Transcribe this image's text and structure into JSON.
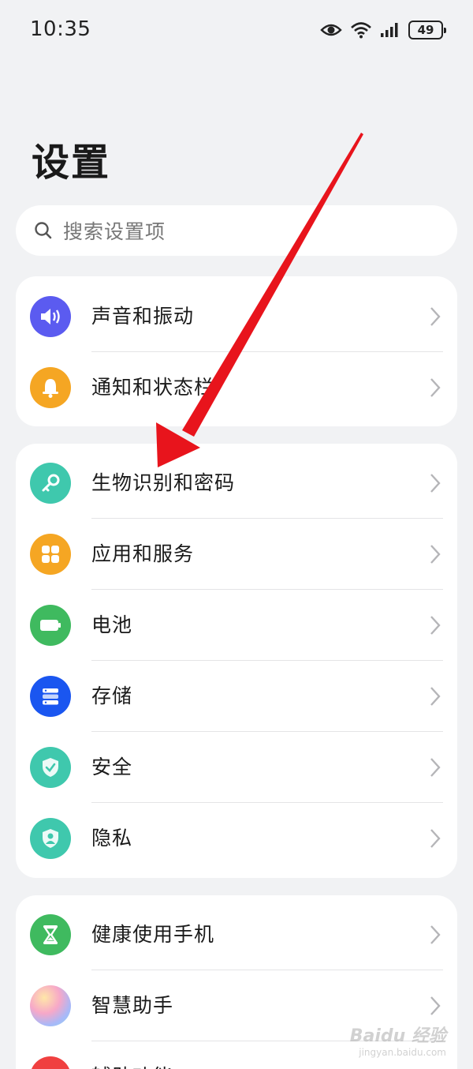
{
  "status_bar": {
    "time": "10:35",
    "battery_level": "49",
    "icons": [
      "eye-icon",
      "wifi-icon",
      "signal-icon",
      "battery-icon"
    ]
  },
  "page": {
    "title": "设置"
  },
  "search": {
    "placeholder": "搜索设置项"
  },
  "groups": [
    {
      "items": [
        {
          "label": "声音和振动",
          "icon": "speaker-icon",
          "color": "#5b5bf0"
        },
        {
          "label": "通知和状态栏",
          "icon": "bell-icon",
          "color": "#f5a623"
        }
      ]
    },
    {
      "items": [
        {
          "label": "生物识别和密码",
          "icon": "key-icon",
          "color": "#3fc8ad"
        },
        {
          "label": "应用和服务",
          "icon": "apps-grid-icon",
          "color": "#f5a623"
        },
        {
          "label": "电池",
          "icon": "battery-icon",
          "color": "#3fba5f"
        },
        {
          "label": "存储",
          "icon": "storage-icon",
          "color": "#1a56f0"
        },
        {
          "label": "安全",
          "icon": "shield-check-icon",
          "color": "#3fc8ad"
        },
        {
          "label": "隐私",
          "icon": "privacy-shield-icon",
          "color": "#3fc8ad"
        }
      ]
    },
    {
      "items": [
        {
          "label": "健康使用手机",
          "icon": "hourglass-icon",
          "color": "#3fba5f"
        },
        {
          "label": "智慧助手",
          "icon": "assistant-orb-icon",
          "color": "#f0a0c0"
        },
        {
          "label": "辅助功能",
          "icon": "accessibility-icon",
          "color": "#f04040"
        }
      ]
    }
  ],
  "annotation": {
    "arrow_color": "#e8141c"
  },
  "watermark": {
    "main": "Baidu 经验",
    "sub": "jingyan.baidu.com"
  }
}
